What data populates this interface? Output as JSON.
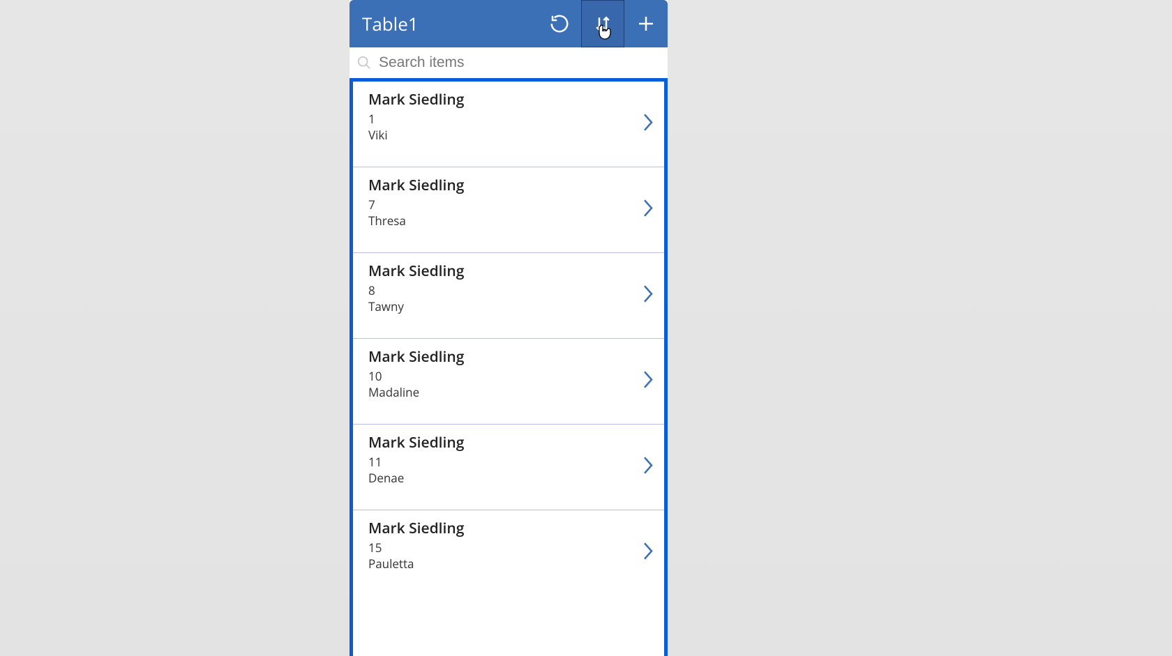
{
  "colors": {
    "header_bg": "#3b6fb6",
    "selection": "#0a5cd7",
    "row_divider": "#b7bfe0"
  },
  "header": {
    "title": "Table1",
    "refresh_icon": "refresh-icon",
    "sort_icon": "sort-icon",
    "add_icon": "plus-icon"
  },
  "search": {
    "placeholder": "Search items",
    "value": ""
  },
  "items": [
    {
      "title": "Mark Siedling",
      "line2": "1",
      "line3": "Viki"
    },
    {
      "title": "Mark Siedling",
      "line2": "7",
      "line3": "Thresa"
    },
    {
      "title": "Mark Siedling",
      "line2": "8",
      "line3": "Tawny"
    },
    {
      "title": "Mark Siedling",
      "line2": "10",
      "line3": "Madaline"
    },
    {
      "title": "Mark Siedling",
      "line2": "11",
      "line3": "Denae"
    },
    {
      "title": "Mark Siedling",
      "line2": "15",
      "line3": "Pauletta"
    }
  ]
}
